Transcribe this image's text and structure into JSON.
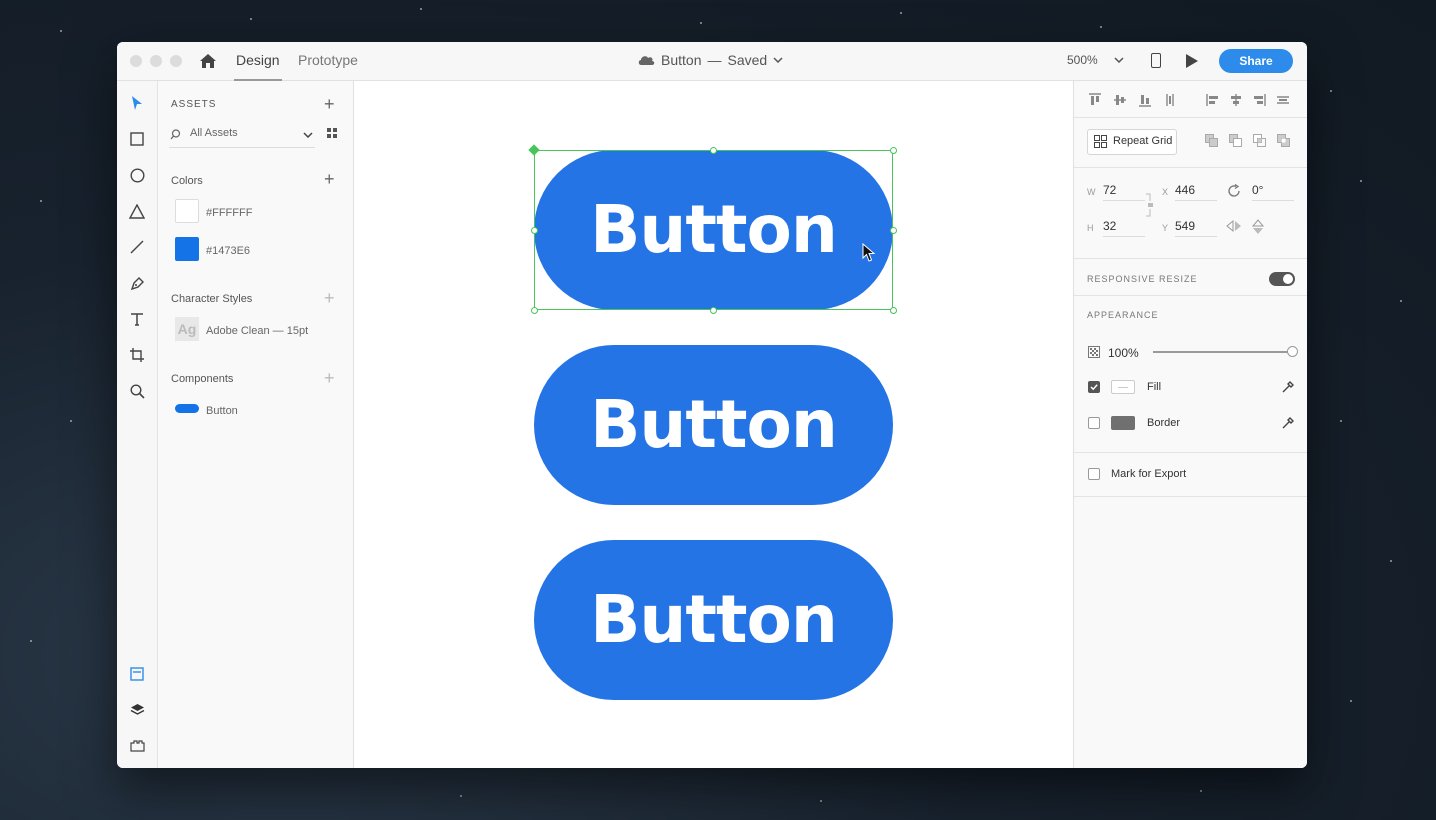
{
  "titlebar": {
    "tabs": [
      "Design",
      "Prototype"
    ],
    "doc_name": "Button",
    "separator": "—",
    "doc_status": "Saved",
    "zoom": "500%",
    "share_label": "Share"
  },
  "assets": {
    "header": "ASSETS",
    "filter": "All Assets",
    "colors_title": "Colors",
    "colors": [
      {
        "hex": "#FFFFFF",
        "label": "#FFFFFF"
      },
      {
        "hex": "#1473E6",
        "label": "#1473E6"
      }
    ],
    "char_styles_title": "Character Styles",
    "char_style_sample": "Ag",
    "char_style_label": "Adobe Clean — 15pt",
    "components_title": "Components",
    "component_label": "Button"
  },
  "canvas": {
    "buttons": [
      "Button",
      "Button",
      "Button"
    ],
    "button_color": "#2474e6",
    "selection_color": "#47c45a",
    "selected_index": 0
  },
  "inspector": {
    "repeat_grid_label": "Repeat Grid",
    "w_label": "W",
    "w_value": "72",
    "h_label": "H",
    "h_value": "32",
    "x_label": "X",
    "x_value": "446",
    "y_label": "Y",
    "y_value": "549",
    "rotation": "0°",
    "responsive_resize": "RESPONSIVE RESIZE",
    "responsive_on": true,
    "appearance": "APPEARANCE",
    "opacity": "100%",
    "opacity_level": 1.0,
    "fill_label": "Fill",
    "fill_checked": true,
    "border_label": "Border",
    "border_checked": false,
    "export_label": "Mark for Export"
  }
}
